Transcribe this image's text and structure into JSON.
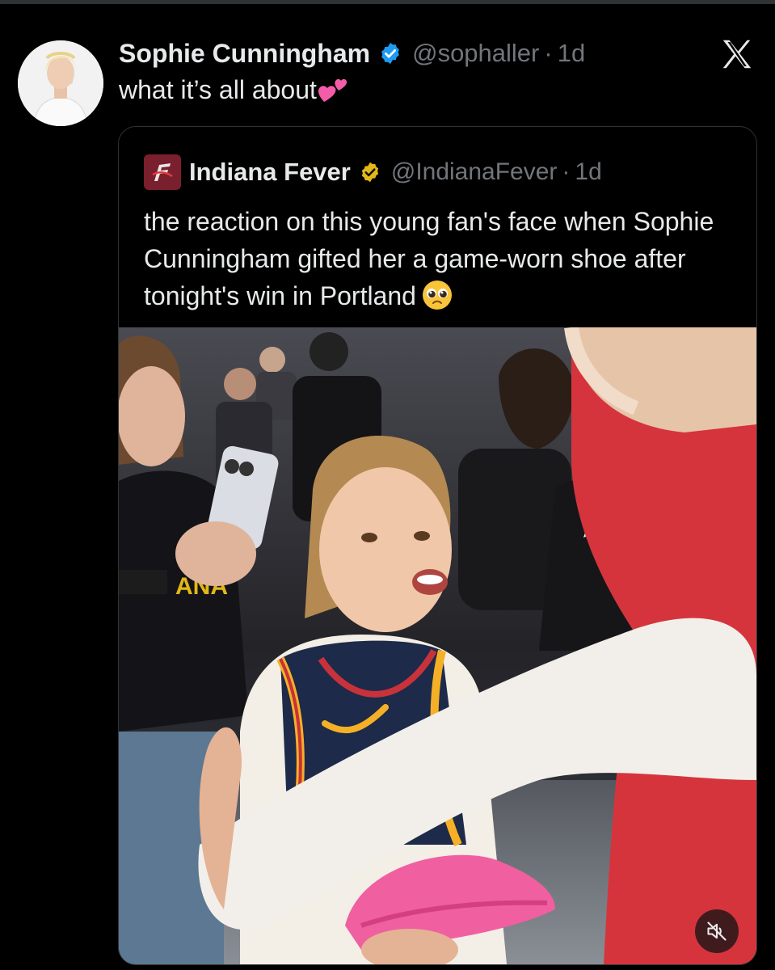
{
  "tweet": {
    "author_name": "Sophie Cunningham",
    "handle": "@sophaller",
    "time": "1d",
    "text": "what it’s all about",
    "text_emoji": "two-hearts"
  },
  "quoted": {
    "author_name": "Indiana Fever",
    "handle": "@IndianaFever",
    "time": "1d",
    "text": "the reaction on this young fan's face when Sophie Cunningham gifted her a game-worn shoe after tonight's win in Portland",
    "text_emoji": "pleading-face",
    "media": {
      "description_icon": "video-frame",
      "mute_icon": "muted-speaker-icon"
    }
  },
  "colors": {
    "background": "#000000",
    "text": "#e7e9ea",
    "muted": "#71767b",
    "verified_blue": "#1d9bf0",
    "verified_gold": "#e2b719",
    "border": "#2f3336"
  }
}
